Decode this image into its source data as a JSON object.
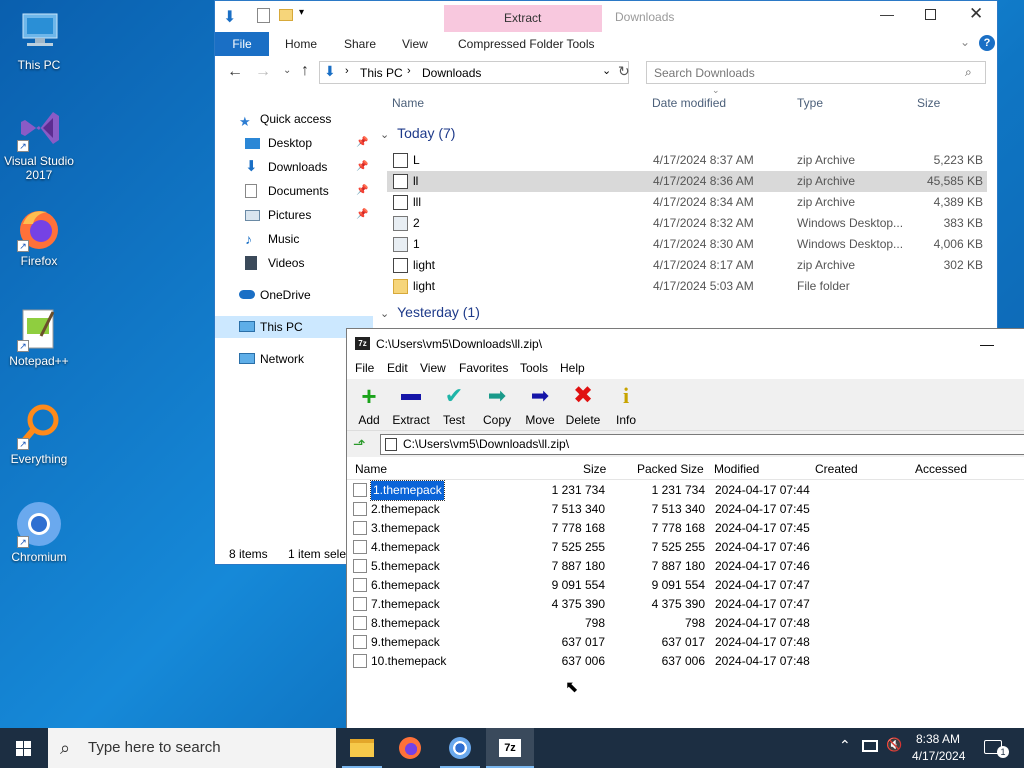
{
  "desktop": {
    "icons": [
      {
        "label": "This PC"
      },
      {
        "label": "Visual Studio 2017"
      },
      {
        "label": "Firefox"
      },
      {
        "label": "Notepad++"
      },
      {
        "label": "Everything"
      },
      {
        "label": "Chromium"
      }
    ]
  },
  "explorer": {
    "title": "Downloads",
    "context_tab": "Extract",
    "tabs": [
      "File",
      "Home",
      "Share",
      "View",
      "Compressed Folder Tools"
    ],
    "breadcrumb": [
      "This PC",
      "Downloads"
    ],
    "search_placeholder": "Search Downloads",
    "nav": [
      {
        "label": "Quick access"
      },
      {
        "label": "Desktop"
      },
      {
        "label": "Downloads"
      },
      {
        "label": "Documents"
      },
      {
        "label": "Pictures"
      },
      {
        "label": "Music"
      },
      {
        "label": "Videos"
      },
      {
        "label": "OneDrive"
      },
      {
        "label": "This PC"
      },
      {
        "label": "Network"
      }
    ],
    "columns": [
      "Name",
      "Date modified",
      "Type",
      "Size"
    ],
    "groups": [
      "Today (7)",
      "Yesterday (1)"
    ],
    "files": [
      {
        "name": "L",
        "date": "4/17/2024 8:37 AM",
        "type": "zip Archive",
        "size": "5,223 KB",
        "icon": "zip"
      },
      {
        "name": "ll",
        "date": "4/17/2024 8:36 AM",
        "type": "zip Archive",
        "size": "45,585 KB",
        "icon": "zip"
      },
      {
        "name": "lll",
        "date": "4/17/2024 8:34 AM",
        "type": "zip Archive",
        "size": "4,389 KB",
        "icon": "zip"
      },
      {
        "name": "2",
        "date": "4/17/2024 8:32 AM",
        "type": "Windows Desktop...",
        "size": "383 KB",
        "icon": "theme"
      },
      {
        "name": "1",
        "date": "4/17/2024 8:30 AM",
        "type": "Windows Desktop...",
        "size": "4,006 KB",
        "icon": "theme"
      },
      {
        "name": "light",
        "date": "4/17/2024 8:17 AM",
        "type": "zip Archive",
        "size": "302 KB",
        "icon": "zip"
      },
      {
        "name": "light",
        "date": "4/17/2024 5:03 AM",
        "type": "File folder",
        "size": "",
        "icon": "folder"
      }
    ],
    "status_items": "8 items",
    "status_selected": "1 item selec"
  },
  "sevenzip": {
    "title": "C:\\Users\\vm5\\Downloads\\ll.zip\\",
    "menu": [
      "File",
      "Edit",
      "View",
      "Favorites",
      "Tools",
      "Help"
    ],
    "toolbar": [
      "Add",
      "Extract",
      "Test",
      "Copy",
      "Move",
      "Delete",
      "Info"
    ],
    "path": "C:\\Users\\vm5\\Downloads\\ll.zip\\",
    "columns": [
      "Name",
      "Size",
      "Packed Size",
      "Modified",
      "Created",
      "Accessed"
    ],
    "rows": [
      {
        "name": "1.themepack",
        "size": "1 231 734",
        "packed": "1 231 734",
        "modified": "2024-04-17 07:44"
      },
      {
        "name": "2.themepack",
        "size": "7 513 340",
        "packed": "7 513 340",
        "modified": "2024-04-17 07:45"
      },
      {
        "name": "3.themepack",
        "size": "7 778 168",
        "packed": "7 778 168",
        "modified": "2024-04-17 07:45"
      },
      {
        "name": "4.themepack",
        "size": "7 525 255",
        "packed": "7 525 255",
        "modified": "2024-04-17 07:46"
      },
      {
        "name": "5.themepack",
        "size": "7 887 180",
        "packed": "7 887 180",
        "modified": "2024-04-17 07:46"
      },
      {
        "name": "6.themepack",
        "size": "9 091 554",
        "packed": "9 091 554",
        "modified": "2024-04-17 07:47"
      },
      {
        "name": "7.themepack",
        "size": "4 375 390",
        "packed": "4 375 390",
        "modified": "2024-04-17 07:47"
      },
      {
        "name": "8.themepack",
        "size": "798",
        "packed": "798",
        "modified": "2024-04-17 07:48"
      },
      {
        "name": "9.themepack",
        "size": "637 017",
        "packed": "637 017",
        "modified": "2024-04-17 07:48"
      },
      {
        "name": "10.themepack",
        "size": "637 006",
        "packed": "637 006",
        "modified": "2024-04-17 07:48"
      }
    ]
  },
  "taskbar": {
    "search_placeholder": "Type here to search",
    "time": "8:38 AM",
    "date": "4/17/2024",
    "notification_count": "1"
  },
  "colors": {
    "accent": "#1a6fc5",
    "selection": "#cce8ff",
    "context_tab": "#f8c8de",
    "taskbar": "#1c2e42"
  }
}
